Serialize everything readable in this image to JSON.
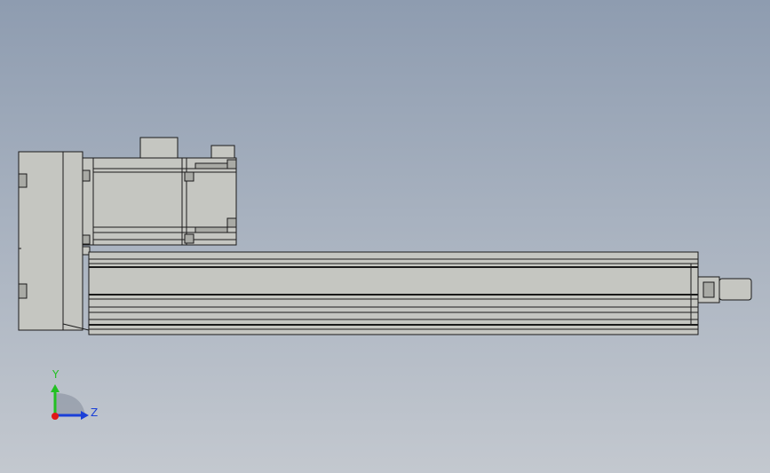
{
  "viewport": {
    "background_top": "#8e9cb0",
    "background_bottom": "#c3c8cf"
  },
  "model": {
    "fill": "#c5c6c1",
    "edge": "#1a1a1a",
    "shade": "#a9aaa5"
  },
  "triad": {
    "y_label": "Y",
    "z_label": "Z",
    "y_color": "#22c022",
    "z_color": "#1a3fd8",
    "x_color": "#e01818"
  }
}
